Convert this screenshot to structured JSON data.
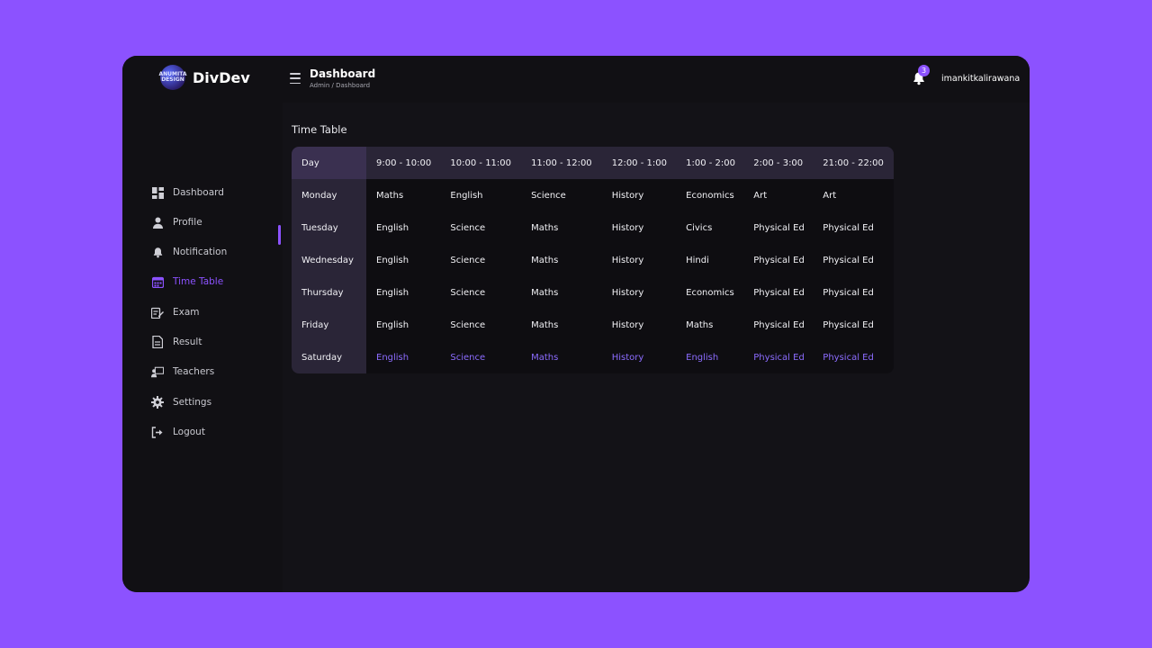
{
  "brand": {
    "name": "DivDev",
    "logo_text": "ANUMITA DESIGN"
  },
  "header": {
    "title": "Dashboard",
    "breadcrumb": "Admin / Dashboard",
    "notification_count": "3",
    "username": "imankitkalirawana"
  },
  "sidebar": {
    "items": [
      {
        "label": "Dashboard",
        "icon": "dashboard-icon"
      },
      {
        "label": "Profile",
        "icon": "user-icon"
      },
      {
        "label": "Notification",
        "icon": "bell-icon"
      },
      {
        "label": "Time Table",
        "icon": "calendar-icon",
        "active": true
      },
      {
        "label": "Exam",
        "icon": "exam-icon"
      },
      {
        "label": "Result",
        "icon": "document-icon"
      },
      {
        "label": "Teachers",
        "icon": "teacher-icon"
      },
      {
        "label": "Settings",
        "icon": "gear-icon"
      },
      {
        "label": "Logout",
        "icon": "logout-icon"
      }
    ]
  },
  "timetable": {
    "title": "Time Table",
    "columns": [
      "Day",
      "9:00 - 10:00",
      "10:00 - 11:00",
      "11:00 - 12:00",
      "12:00 - 1:00",
      "1:00 - 2:00",
      "2:00 - 3:00",
      "21:00 - 22:00"
    ],
    "rows": [
      {
        "day": "Monday",
        "subjects": [
          "Maths",
          "English",
          "Science",
          "History",
          "Economics",
          "Art",
          "Art"
        ]
      },
      {
        "day": "Tuesday",
        "subjects": [
          "English",
          "Science",
          "Maths",
          "History",
          "Civics",
          "Physical Ed",
          "Physical Ed"
        ]
      },
      {
        "day": "Wednesday",
        "subjects": [
          "English",
          "Science",
          "Maths",
          "History",
          "Hindi",
          "Physical Ed",
          "Physical Ed"
        ]
      },
      {
        "day": "Thursday",
        "subjects": [
          "English",
          "Science",
          "Maths",
          "History",
          "Economics",
          "Physical Ed",
          "Physical Ed"
        ]
      },
      {
        "day": "Friday",
        "subjects": [
          "English",
          "Science",
          "Maths",
          "History",
          "Maths",
          "Physical Ed",
          "Physical Ed"
        ]
      },
      {
        "day": "Saturday",
        "subjects": [
          "English",
          "Science",
          "Maths",
          "History",
          "English",
          "Physical Ed",
          "Physical Ed"
        ]
      }
    ]
  },
  "colors": {
    "background": "#8c52ff",
    "accent": "#8c52ff",
    "panel": "#131217"
  }
}
